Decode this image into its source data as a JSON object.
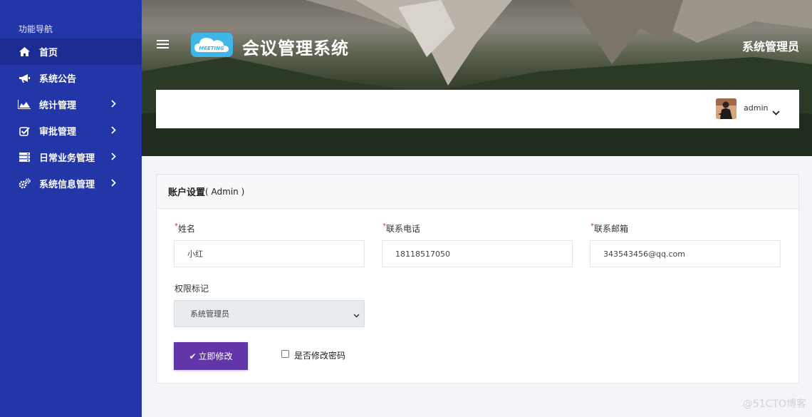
{
  "sidebar": {
    "title": "功能导航",
    "items": [
      {
        "label": "首页",
        "icon": "home-icon"
      },
      {
        "label": "系统公告",
        "icon": "megaphone-icon"
      },
      {
        "label": "统计管理",
        "icon": "area-chart-icon"
      },
      {
        "label": "审批管理",
        "icon": "check-square-icon"
      },
      {
        "label": "日常业务管理",
        "icon": "server-icon"
      },
      {
        "label": "系统信息管理",
        "icon": "cogs-icon"
      }
    ]
  },
  "header": {
    "logo_text": "MEETING",
    "app_title": "会议管理系统",
    "role_title": "系统管理员",
    "user_name": "admin"
  },
  "account": {
    "title": "账户设置",
    "title_suffix": "( Admin )",
    "required_mark": "*",
    "name_label": "姓名",
    "name_value": "小红",
    "phone_label": "联系电话",
    "phone_value": "18118517050",
    "email_label": "联系邮箱",
    "email_value": "343543456@qq.com",
    "role_label": "权限标记",
    "role_value": "系统管理员",
    "submit_label": "立即修改",
    "change_password_label": "是否修改密码"
  },
  "watermark": "@51CTO博客",
  "colors": {
    "sidebar_bg": "#2336a8",
    "sidebar_active": "#1c2c93",
    "submit_button": "#6235a8",
    "logo_bg": "#3eb6e8",
    "required": "#e0302f"
  }
}
